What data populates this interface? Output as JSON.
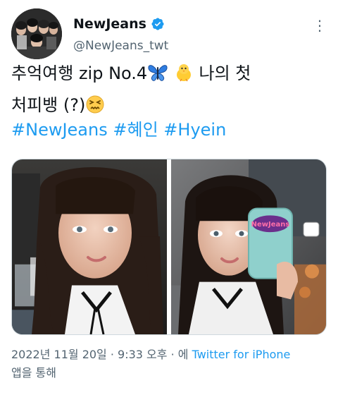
{
  "author": {
    "display_name": "NewJeans",
    "handle": "@NewJeans_twt",
    "verified": true
  },
  "more_icon": "⋮",
  "tweet": {
    "line1_text": "추억여행 zip No.4",
    "line1_emojis": [
      "butterfly-icon",
      "chick-icon"
    ],
    "line1_suffix": "나의 첫",
    "line2_text": "처피뱅 (?)",
    "line2_emoji": "confounded-face-icon"
  },
  "hashtags": [
    "#NewJeans",
    "#혜인",
    "#Hyein"
  ],
  "media": {
    "photos": [
      {
        "name": "photo-1"
      },
      {
        "name": "photo-2"
      }
    ],
    "phone_case_text": "NewJeans"
  },
  "meta": {
    "timestamp": "2022년 11월 20일 · 9:33 오후 · 에",
    "source": "Twitter for iPhone",
    "suffix": "앱을 통해"
  },
  "colors": {
    "accent": "#1d9bf0",
    "text": "#0f1419",
    "secondary": "#536471"
  }
}
